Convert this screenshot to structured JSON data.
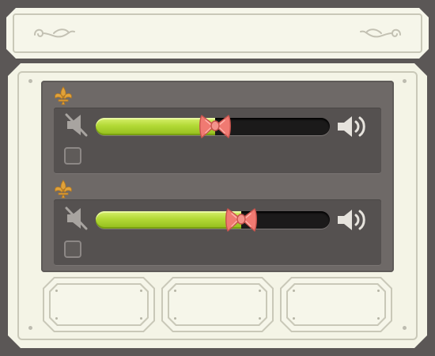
{
  "header": {
    "title": "",
    "left_ornament": "scroll-ornament-icon",
    "right_ornament": "scroll-ornament-icon"
  },
  "sliders": [
    {
      "label": "",
      "label_icon": "fleur-de-lis-icon",
      "value_fraction": 0.51,
      "min_icon": "speaker-muted-icon",
      "max_icon": "speaker-loud-icon",
      "handle_icon": "bow-icon",
      "mute_checked": false
    },
    {
      "label": "",
      "label_icon": "fleur-de-lis-icon",
      "value_fraction": 0.62,
      "min_icon": "speaker-muted-icon",
      "max_icon": "speaker-loud-icon",
      "handle_icon": "bow-icon",
      "mute_checked": false
    }
  ],
  "buttons": [
    {
      "label": ""
    },
    {
      "label": ""
    },
    {
      "label": ""
    }
  ],
  "colors": {
    "frame": "#5b5756",
    "board": "#f4f4e6",
    "panel": "#6e6967",
    "slider_fill": "#b2d935",
    "bow": "#f07a72",
    "fleur": "#e0a23a"
  }
}
